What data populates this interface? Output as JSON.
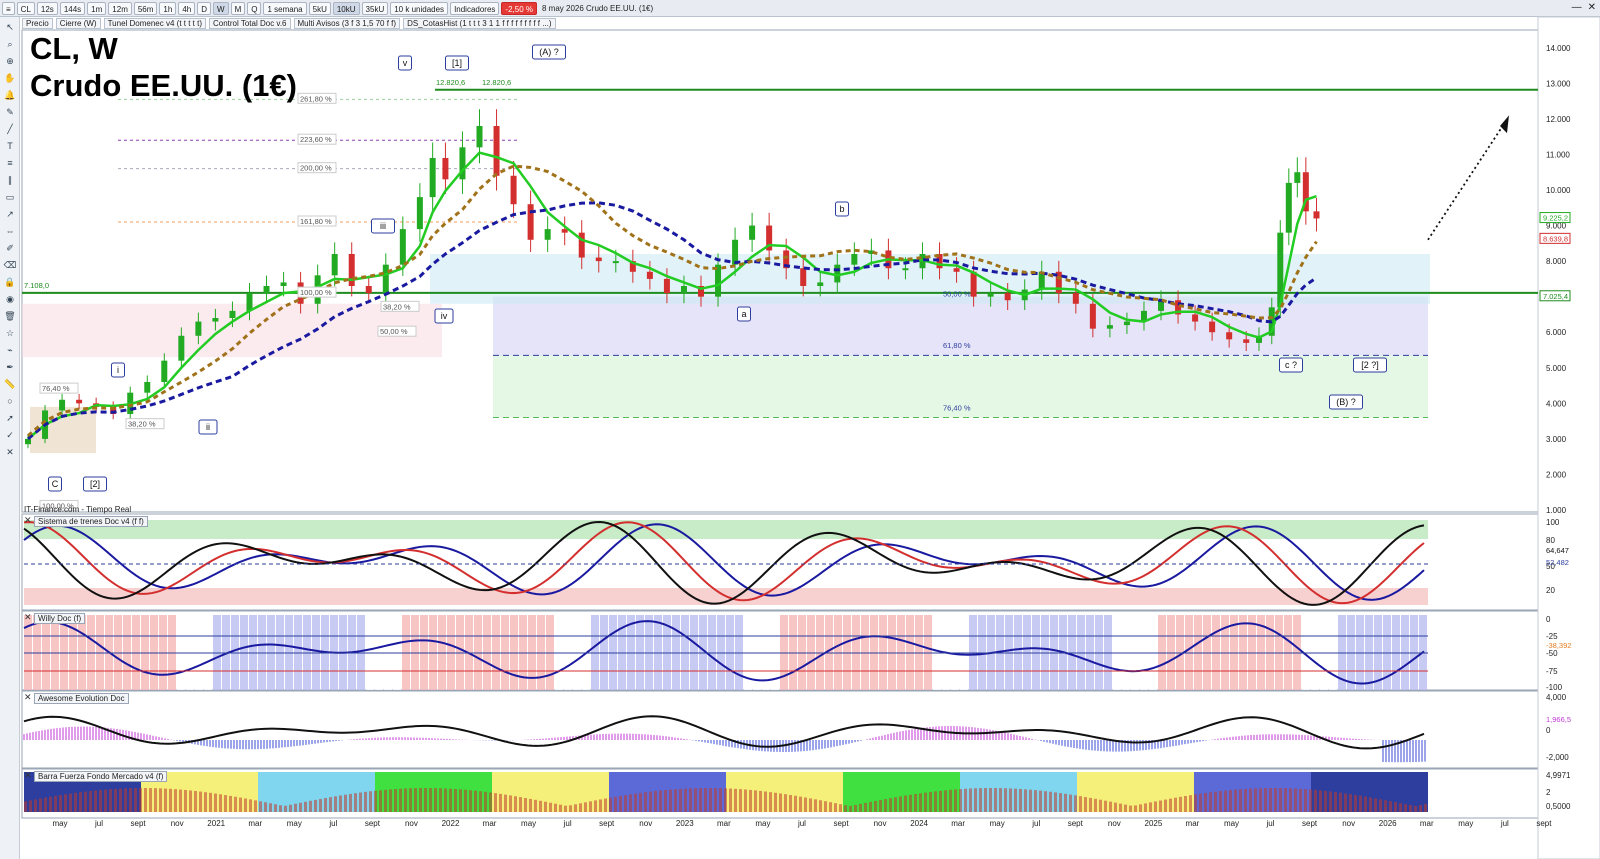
{
  "toolbar": {
    "symbol": "CL",
    "timeframes": [
      "12s",
      "144s",
      "1m",
      "12m",
      "56m",
      "1h",
      "4h",
      "D",
      "W",
      "M",
      "Q"
    ],
    "active_timeframe": "W",
    "period": "1 semana",
    "volumes": [
      "5kU",
      "10kU",
      "35kU"
    ],
    "active_volume": "10kU",
    "units": "10 k unidades",
    "indicators_label": "Indicadores",
    "change": "-2,50 %",
    "info": "8 may 2026  Crudo EE.UU. (1€)"
  },
  "indicator_tags": [
    "Precio",
    "Cierre (W)",
    "Tunel Domenec v4 (t t t t t)",
    "Control Total Doc v.6",
    "Multi Avisos (3 f 3 1,5 70 f f)",
    "DS_CotasHist (1 t t t 3 1 1 f f f f f f f f f ...)"
  ],
  "title_line1": "CL, W",
  "title_line2": "Crudo EE.UU. (1€)",
  "source_note": "IT-Finance.com - Tiempo Real",
  "colors": {
    "up": "#22aa22",
    "down": "#d32f2f",
    "wave": "#2d3e9e",
    "fibo_green": "#3a9a3a",
    "support": "#1e8c1e"
  },
  "chart_data": [
    {
      "type": "candlestick",
      "panel": "price",
      "x_axis_labels": [
        "may",
        "jul",
        "sept",
        "nov",
        "2021",
        "mar",
        "may",
        "jul",
        "sept",
        "nov",
        "2022",
        "mar",
        "may",
        "jul",
        "sept",
        "nov",
        "2023",
        "mar",
        "may",
        "jul",
        "sept",
        "nov",
        "2024",
        "mar",
        "may",
        "jul",
        "sept",
        "nov",
        "2025",
        "mar",
        "may",
        "jul",
        "sept",
        "nov",
        "2026",
        "mar",
        "may",
        "jul",
        "sept"
      ],
      "ylim": [
        1,
        14.5
      ],
      "y_ticks": [
        "1.000",
        "2.000",
        "3.000",
        "4.000",
        "5.000",
        "6.000",
        "7.000",
        "8.000",
        "9.000",
        "10.000",
        "11.000",
        "12.000",
        "13.000",
        "14.000"
      ],
      "y_badges": [
        {
          "label": "9.225,2",
          "value": 9.225,
          "color": "#22aa22"
        },
        {
          "label": "8.639,8",
          "value": 8.64,
          "color": "#d32f2f"
        },
        {
          "label": "7.025,4",
          "value": 7.025,
          "color": "#1e8c1e"
        }
      ],
      "hlines": [
        {
          "value": 12.82,
          "color": "#1e8c1e"
        },
        {
          "value": 7.108,
          "color": "#1e8c1e"
        }
      ],
      "hline_labels": [
        "12.820,6",
        "12.820,6",
        "7.108,0"
      ],
      "fibo_left": [
        "261,80 %",
        "223,60 %",
        "200,00 %",
        "161,80 %",
        "100,00 %",
        "50,00 %",
        "38,20 %",
        "76,40 %",
        "38,20 %",
        "100,00 %"
      ],
      "fibo_right": [
        "50,00 %",
        "61,80 %",
        "76,40 %"
      ],
      "wave_labels": [
        "[2]",
        "C",
        "i",
        "ii",
        "iii",
        "iv",
        "v",
        "[1]",
        "(A) ?",
        "a",
        "b",
        "c ?",
        "[2 ?]",
        "(B) ?"
      ],
      "series": [
        {
          "name": "Close (weekly)",
          "x": [
            2020.3,
            2020.38,
            2020.46,
            2020.54,
            2020.62,
            2020.7,
            2020.78,
            2020.86,
            2020.94,
            2021.02,
            2021.1,
            2021.18,
            2021.26,
            2021.34,
            2021.42,
            2021.5,
            2021.58,
            2021.66,
            2021.74,
            2021.82,
            2021.9,
            2021.98,
            2022.06,
            2022.14,
            2022.2,
            2022.26,
            2022.34,
            2022.42,
            2022.5,
            2022.58,
            2022.66,
            2022.74,
            2022.82,
            2022.9,
            2022.98,
            2023.06,
            2023.14,
            2023.22,
            2023.3,
            2023.38,
            2023.46,
            2023.54,
            2023.62,
            2023.7,
            2023.78,
            2023.86,
            2023.94,
            2024.02,
            2024.1,
            2024.18,
            2024.26,
            2024.34,
            2024.42,
            2024.5,
            2024.58,
            2024.66,
            2024.74,
            2024.82,
            2024.9,
            2024.98,
            2025.06,
            2025.14,
            2025.22,
            2025.3,
            2025.38,
            2025.46,
            2025.54,
            2025.62,
            2025.7,
            2025.78,
            2025.86,
            2025.94,
            2026.02,
            2026.08,
            2026.14,
            2026.18,
            2026.22,
            2026.26,
            2026.3,
            2026.35
          ],
          "y": [
            3.0,
            3.8,
            4.1,
            4.0,
            3.9,
            3.7,
            4.3,
            4.6,
            5.2,
            5.9,
            6.3,
            6.4,
            6.6,
            7.1,
            7.3,
            7.4,
            6.8,
            7.6,
            8.2,
            7.3,
            7.1,
            7.9,
            8.9,
            9.8,
            10.9,
            10.3,
            11.2,
            11.8,
            10.4,
            9.6,
            8.6,
            8.9,
            8.8,
            8.1,
            8.0,
            8.0,
            7.7,
            7.5,
            7.1,
            7.3,
            7.0,
            7.9,
            8.6,
            9.0,
            8.3,
            7.8,
            7.3,
            7.4,
            7.9,
            8.2,
            8.3,
            7.8,
            7.8,
            8.2,
            7.8,
            7.7,
            7.0,
            7.1,
            6.9,
            7.2,
            7.7,
            7.1,
            6.8,
            6.1,
            6.2,
            6.3,
            6.6,
            6.9,
            6.5,
            6.3,
            6.0,
            5.8,
            5.7,
            5.9,
            6.7,
            8.8,
            10.2,
            10.5,
            9.4,
            9.2
          ]
        }
      ]
    },
    {
      "type": "line",
      "panel": "Sistema de trenes Doc v4 (f f)",
      "ylim": [
        0,
        100
      ],
      "y_ticks": [
        "100",
        "80",
        "50",
        "20"
      ],
      "badges": [
        "64,647",
        "52,482"
      ]
    },
    {
      "type": "line",
      "panel": "Willy Doc (f)",
      "ylim": [
        -100,
        0
      ],
      "y_ticks": [
        "0",
        "-25",
        "-50",
        "-75",
        "-100"
      ],
      "badges": [
        "-38,392"
      ]
    },
    {
      "type": "histogram",
      "panel": "Awesome Evolution Doc",
      "y_ticks": [
        "4,000",
        "0",
        "-2,000"
      ],
      "badges": [
        "1,966,5"
      ]
    },
    {
      "type": "histogram",
      "panel": "Barra Fuerza Fondo Mercado v4 (f)",
      "y_ticks": [
        "4,9971",
        "2",
        "0,5000"
      ]
    }
  ],
  "panels": {
    "trenes_title": "Sistema de trenes Doc v4 (f f)",
    "willy_title": "Willy Doc (f)",
    "awesome_title": "Awesome Evolution Doc",
    "barra_title": "Barra Fuerza Fondo Mercado v4 (f)"
  }
}
